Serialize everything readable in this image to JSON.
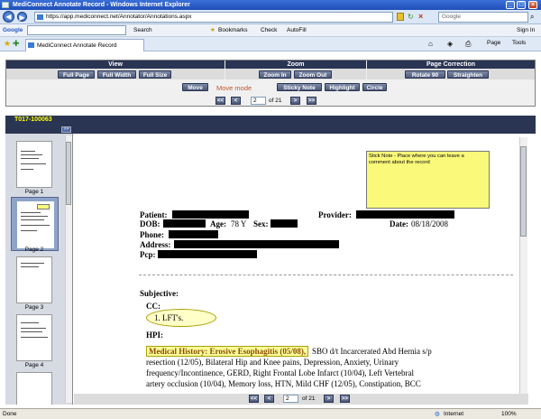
{
  "window": {
    "title": "MediConnect Annotate Record - Windows Internet Explorer"
  },
  "browser": {
    "url": "https://app.mediconnect.net/Annotator/Annotations.aspx",
    "search_placeholder": "Google",
    "google_label": "Google",
    "google_bar_items": [
      "Search",
      "Bookmarks",
      "Check",
      "AutoFill",
      "Sign In"
    ],
    "tab_title": "MediConnect Annotate Record",
    "page_menu": "Page",
    "tools_menu": "Tools"
  },
  "toolbar": {
    "groups": [
      {
        "title": "View",
        "buttons": [
          "Full Page",
          "Full Width",
          "Full Size"
        ]
      },
      {
        "title": "Zoom",
        "buttons": [
          "Zoom In",
          "Zoom Out"
        ]
      },
      {
        "title": "Page Correction",
        "buttons": [
          "Rotate 90",
          "Straighten"
        ]
      }
    ],
    "mode_buttons": [
      "Move",
      "Sticky Note",
      "Highlight",
      "Circle"
    ],
    "mode_label": "Move mode",
    "pager": {
      "first": "<<",
      "prev": "<",
      "current": "2",
      "of_label": "of 21",
      "next": ">",
      "last": ">>"
    }
  },
  "record": {
    "id": "T017-100063",
    "expand_label": ">>"
  },
  "thumbnails": [
    {
      "label": "Page 1"
    },
    {
      "label": "Page 2"
    },
    {
      "label": "Page 3"
    },
    {
      "label": "Page 4"
    }
  ],
  "document": {
    "sticky_note": "Stick Note - Place where you can leave a comment about the record",
    "patient_label": "Patient:",
    "provider_label": "Provider:",
    "dob_label": "DOB:",
    "age_label": "Age:",
    "age_value": "78 Y",
    "sex_label": "Sex:",
    "date_label": "Date:",
    "date_value": "08/18/2008",
    "phone_label": "Phone:",
    "address_label": "Address:",
    "pcp_label": "Pcp:",
    "subjective_label": "Subjective:",
    "cc_label": "CC:",
    "cc_item": "1. LFT's.",
    "hpi_label": "HPI:",
    "medical_history_highlight": "Medical History: Erosive Esophagitis (05/08),",
    "history_lines": [
      "SBO d/t Incarcerated Abd Hernia s/p",
      "resection (12/05), Bilateral Hip and Knee pains, Depression, Anxiety, Urinary",
      "frequency/Incontinence, GERD, Right Frontal Lobe Infarct (10/04), Left Vertebral",
      "artery occlusion (10/04), Memory loss, HTN, Mild CHF (12/05), Constipation, BCC"
    ]
  },
  "status": {
    "left": "Done",
    "zone": "Internet",
    "zoom": "100%"
  }
}
